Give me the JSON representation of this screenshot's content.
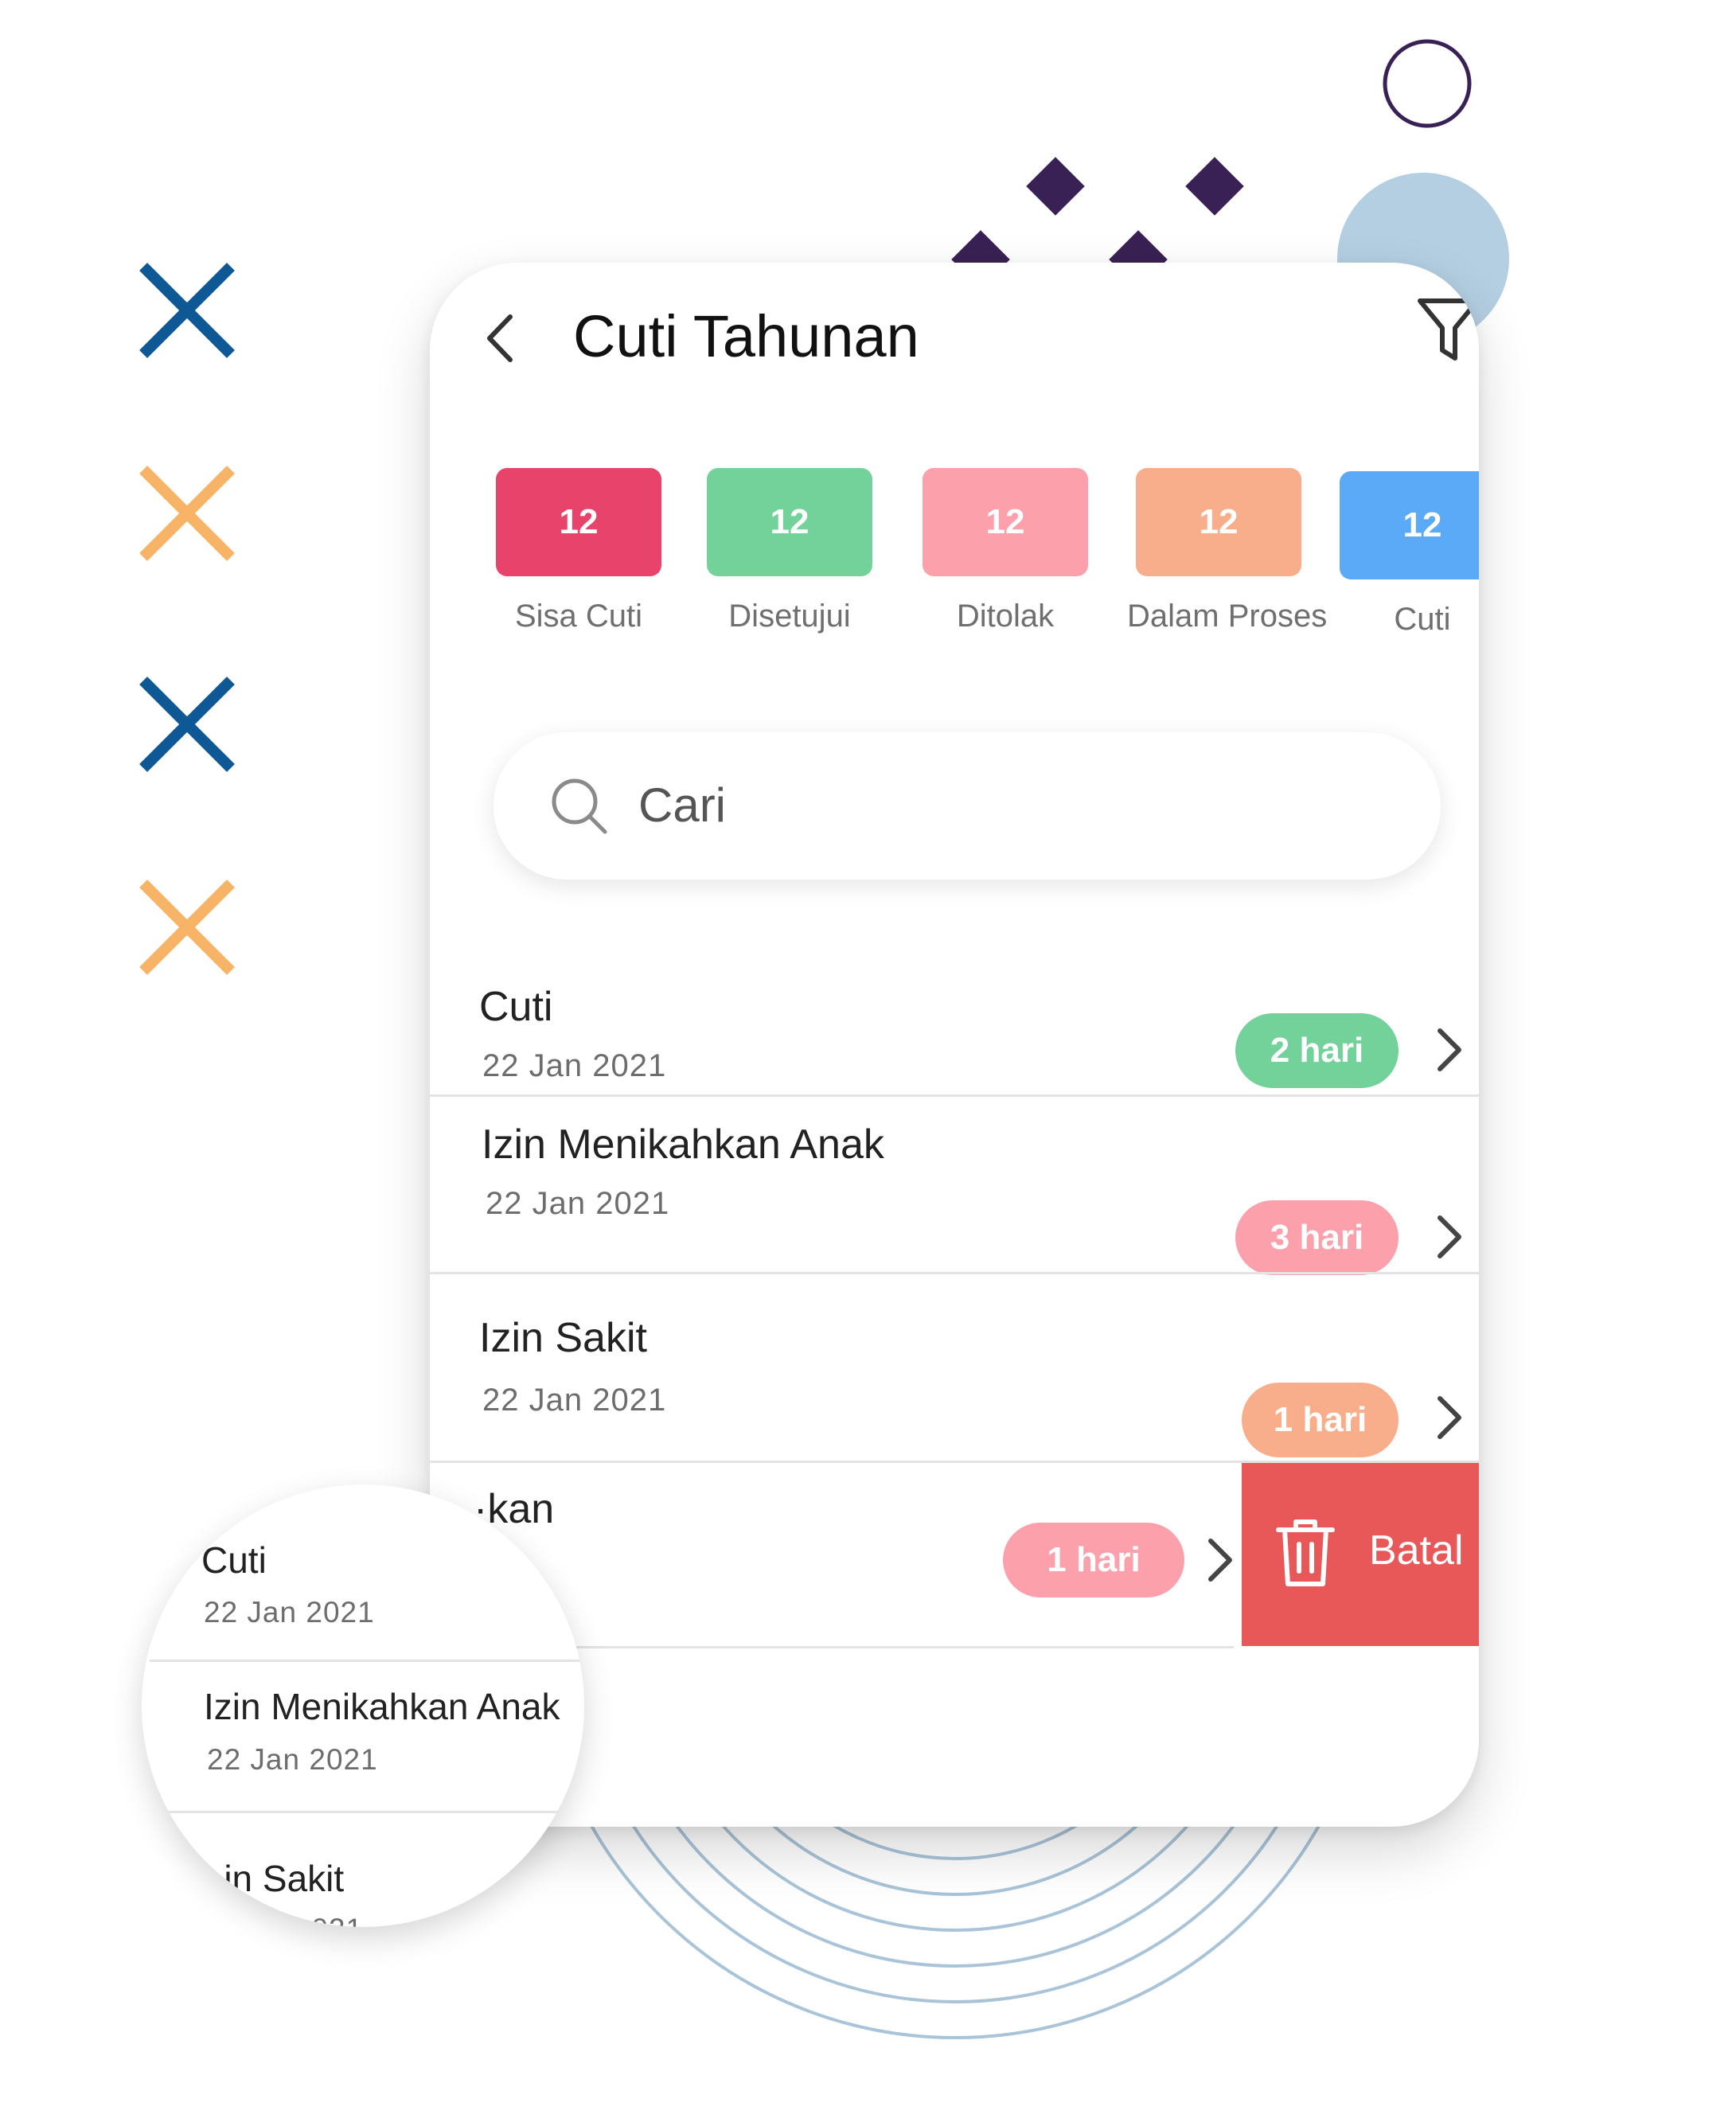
{
  "header": {
    "title": "Cuti Tahunan"
  },
  "stats": [
    {
      "value": "12",
      "label": "Sisa Cuti",
      "color": "#e8436a"
    },
    {
      "value": "12",
      "label": "Disetujui",
      "color": "#72d29a"
    },
    {
      "value": "12",
      "label": "Ditolak",
      "color": "#fca0ab"
    },
    {
      "value": "12",
      "label": "Dalam Proses",
      "color": "#f8ae8a"
    },
    {
      "value": "12",
      "label": "Cuti",
      "color": "#5aaaf7"
    }
  ],
  "search": {
    "placeholder": "Cari"
  },
  "list": [
    {
      "title": "Cuti",
      "date": "22 Jan 2021",
      "duration": "2 hari",
      "color": "#72d29a"
    },
    {
      "title": "Izin Menikahkan Anak",
      "date": "22 Jan 2021",
      "duration": "3 hari",
      "color": "#fca0ab"
    },
    {
      "title": "Izin Sakit",
      "date": "22 Jan 2021",
      "duration": "1 hari",
      "color": "#f8ae8a"
    },
    {
      "title": "·kan",
      "date": "",
      "duration": "1 hari",
      "color": "#fca0ab"
    }
  ],
  "swipe_action": {
    "label": "Batal",
    "color": "#e85858"
  },
  "magnifier": [
    {
      "title": "Cuti",
      "date": "22 Jan 2021"
    },
    {
      "title": "Izin Menikahkan Anak",
      "date": "22 Jan 2021"
    },
    {
      "title": "·in Sakit",
      "date": "·021"
    }
  ],
  "decoration_colors": {
    "blue": "#0e5896",
    "orange": "#f7b366",
    "purple": "#3a2155",
    "light_blue": "#b4cfe2"
  }
}
